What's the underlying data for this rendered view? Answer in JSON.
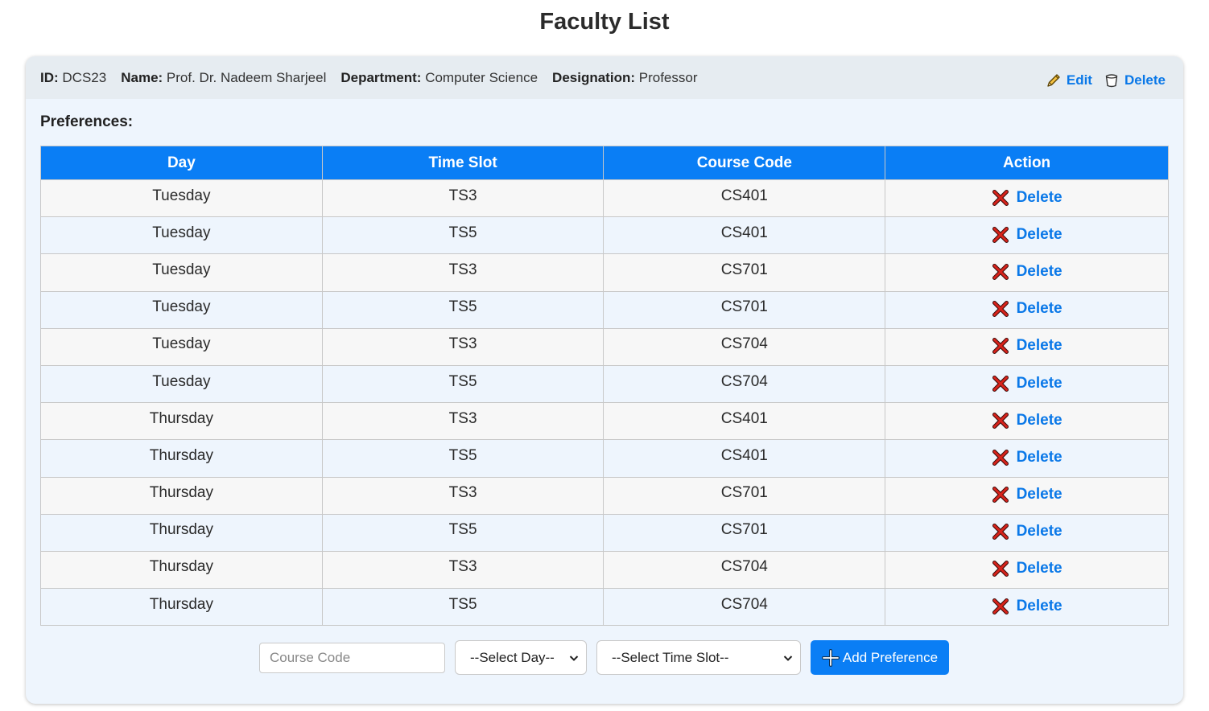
{
  "page": {
    "title": "Faculty List"
  },
  "faculty": {
    "id_label": "ID:",
    "id": "DCS23",
    "name_label": "Name:",
    "name": "Prof. Dr. Nadeem Sharjeel",
    "department_label": "Department:",
    "department": "Computer Science",
    "designation_label": "Designation:",
    "designation": "Professor",
    "edit_label": "Edit",
    "delete_label": "Delete"
  },
  "preferences": {
    "heading": "Preferences:",
    "columns": [
      "Day",
      "Time Slot",
      "Course Code",
      "Action"
    ],
    "rows": [
      {
        "day": "Tuesday",
        "time_slot": "TS3",
        "course_code": "CS401",
        "action": "Delete"
      },
      {
        "day": "Tuesday",
        "time_slot": "TS5",
        "course_code": "CS401",
        "action": "Delete"
      },
      {
        "day": "Tuesday",
        "time_slot": "TS3",
        "course_code": "CS701",
        "action": "Delete"
      },
      {
        "day": "Tuesday",
        "time_slot": "TS5",
        "course_code": "CS701",
        "action": "Delete"
      },
      {
        "day": "Tuesday",
        "time_slot": "TS3",
        "course_code": "CS704",
        "action": "Delete"
      },
      {
        "day": "Tuesday",
        "time_slot": "TS5",
        "course_code": "CS704",
        "action": "Delete"
      },
      {
        "day": "Thursday",
        "time_slot": "TS3",
        "course_code": "CS401",
        "action": "Delete"
      },
      {
        "day": "Thursday",
        "time_slot": "TS5",
        "course_code": "CS401",
        "action": "Delete"
      },
      {
        "day": "Thursday",
        "time_slot": "TS3",
        "course_code": "CS701",
        "action": "Delete"
      },
      {
        "day": "Thursday",
        "time_slot": "TS5",
        "course_code": "CS701",
        "action": "Delete"
      },
      {
        "day": "Thursday",
        "time_slot": "TS3",
        "course_code": "CS704",
        "action": "Delete"
      },
      {
        "day": "Thursday",
        "time_slot": "TS5",
        "course_code": "CS704",
        "action": "Delete"
      }
    ]
  },
  "form": {
    "course_code_placeholder": "Course Code",
    "day_select_value": "--Select Day--",
    "time_slot_select_value": "--Select Time Slot--",
    "add_button_label": "Add Preference"
  },
  "icons": {
    "edit": "pencil-icon",
    "header_delete": "trash-icon",
    "row_delete": "cross-icon",
    "add": "plus-icon",
    "select": "chevron-down-icon"
  },
  "colors": {
    "accent": "#0a7ef5",
    "link": "#0a78e8",
    "delete_x": "#d8231b",
    "header_bg": "#e6ecf1",
    "card_bg": "#eef5fd"
  }
}
